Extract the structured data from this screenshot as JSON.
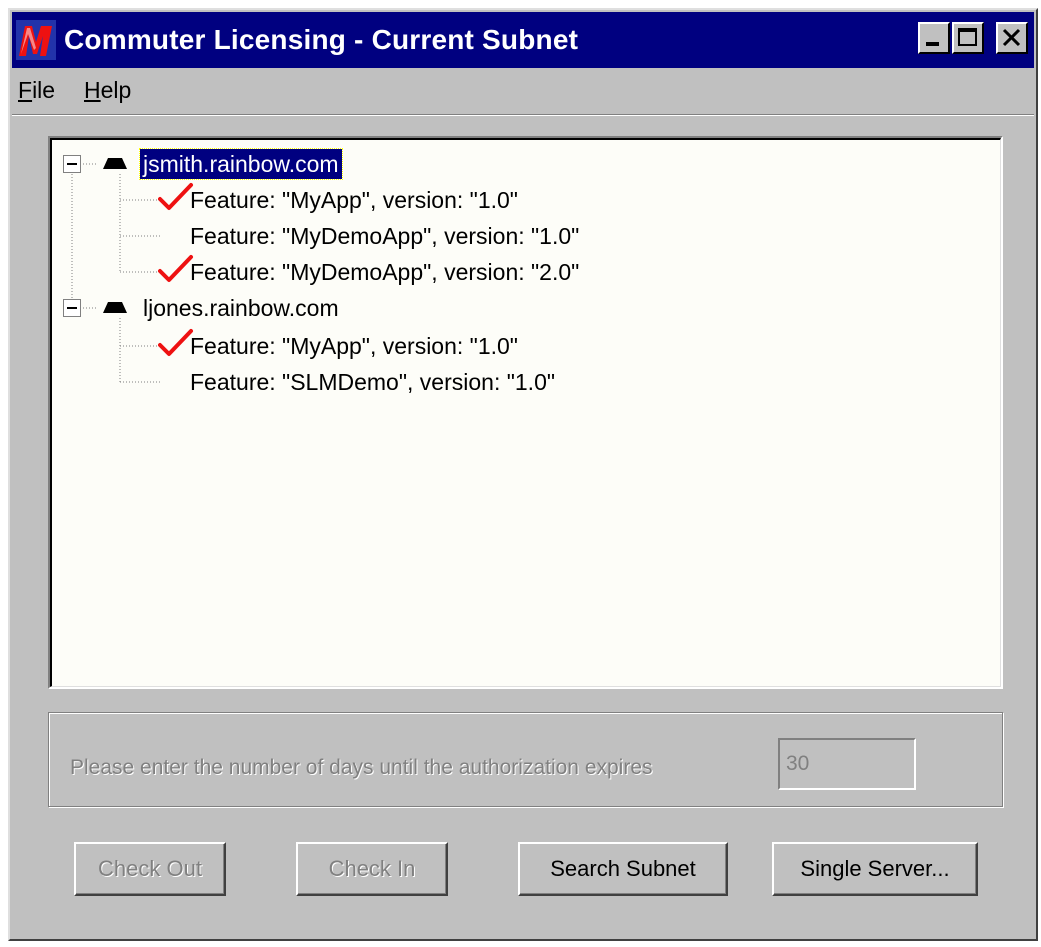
{
  "window": {
    "title": "Commuter Licensing - Current Subnet",
    "titlebar_color": "#000080",
    "buttons": [
      "minimize-icon",
      "maximize-icon",
      "close-icon"
    ]
  },
  "menu": {
    "file": {
      "accel": "F",
      "rest": "ile"
    },
    "help": {
      "accel": "H",
      "rest": "elp"
    }
  },
  "tree": {
    "servers": [
      {
        "name": "jsmith.rainbow.com",
        "selected": true,
        "features": [
          {
            "label": "Feature: \"MyApp\", version: \"1.0\"",
            "checked": true
          },
          {
            "label": "Feature: \"MyDemoApp\", version: \"1.0\"",
            "checked": false
          },
          {
            "label": "Feature: \"MyDemoApp\", version: \"2.0\"",
            "checked": true
          }
        ]
      },
      {
        "name": "ljones.rainbow.com",
        "selected": false,
        "features": [
          {
            "label": "Feature: \"MyApp\", version: \"1.0\"",
            "checked": true
          },
          {
            "label": "Feature: \"SLMDemo\", version: \"1.0\"",
            "checked": false
          }
        ]
      }
    ]
  },
  "expiry": {
    "prompt": "Please enter the number of days until the authorization expires",
    "days": "30"
  },
  "buttons": {
    "check_out": "Check Out",
    "check_in": "Check In",
    "search_subnet": "Search Subnet",
    "single_server": "Single Server..."
  },
  "colors": {
    "check_mark": "#ee1111",
    "selection": "#000080"
  }
}
